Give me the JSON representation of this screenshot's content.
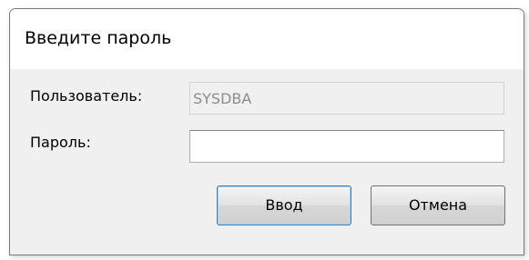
{
  "dialog": {
    "title": "Введите пароль",
    "fields": {
      "user": {
        "label": "Пользователь:",
        "value": "SYSDBA",
        "disabled": true
      },
      "password": {
        "label": "Пароль:",
        "value": ""
      }
    },
    "buttons": {
      "ok_label": "Ввод",
      "cancel_label": "Отмена"
    }
  }
}
